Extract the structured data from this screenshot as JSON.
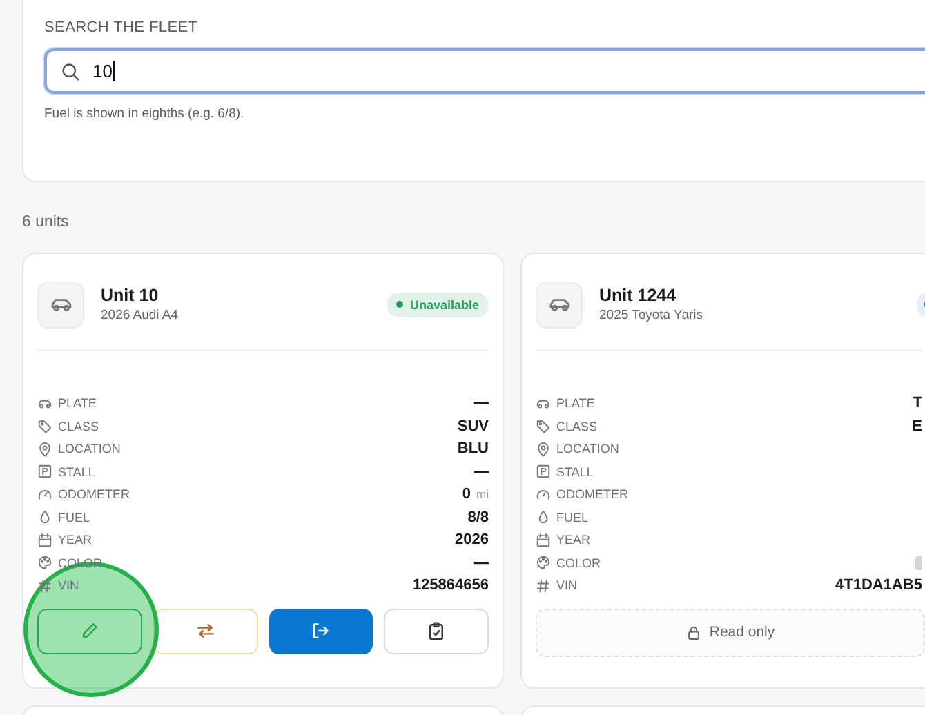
{
  "search": {
    "label": "SEARCH THE FLEET",
    "value": "10",
    "hint": "Fuel is shown in eighths (e.g. 6/8)."
  },
  "count": "6 units",
  "units": [
    {
      "title": "Unit 10",
      "subtitle": "2026 Audi A4",
      "status": {
        "label": "Unavailable",
        "color": "#22a05a"
      },
      "fields": [
        {
          "kind": "plate",
          "label": "PLATE",
          "value": "—"
        },
        {
          "kind": "class",
          "label": "CLASS",
          "value": "SUV"
        },
        {
          "kind": "location",
          "label": "LOCATION",
          "value": "BLU"
        },
        {
          "kind": "stall",
          "label": "STALL",
          "value": "—"
        },
        {
          "kind": "odometer",
          "label": "ODOMETER",
          "value": "0",
          "unit": "mi"
        },
        {
          "kind": "fuel",
          "label": "FUEL",
          "value": "8/8"
        },
        {
          "kind": "year",
          "label": "YEAR",
          "value": "2026"
        },
        {
          "kind": "color",
          "label": "COLOR",
          "value": "—"
        },
        {
          "kind": "vin",
          "label": "VIN",
          "value": "125864656"
        }
      ],
      "actions": [
        {
          "kind": "edit"
        },
        {
          "kind": "transfer"
        },
        {
          "kind": "checkout"
        },
        {
          "kind": "inspect"
        }
      ]
    },
    {
      "title": "Unit 1244",
      "subtitle": "2025 Toyota Yaris",
      "status": {
        "color": "#3b7de0"
      },
      "fields": [
        {
          "kind": "plate",
          "label": "PLATE",
          "value": "T"
        },
        {
          "kind": "class",
          "label": "CLASS",
          "value": "E"
        },
        {
          "kind": "location",
          "label": "LOCATION"
        },
        {
          "kind": "stall",
          "label": "STALL"
        },
        {
          "kind": "odometer",
          "label": "ODOMETER"
        },
        {
          "kind": "fuel",
          "label": "FUEL"
        },
        {
          "kind": "year",
          "label": "YEAR"
        },
        {
          "kind": "color",
          "label": "COLOR",
          "color": "#d4d6da"
        },
        {
          "kind": "vin",
          "label": "VIN",
          "value": "4T1DA1AB5"
        }
      ],
      "actions": [
        {
          "kind": "read_only",
          "label": "Read only"
        }
      ]
    }
  ],
  "click_highlight": true
}
